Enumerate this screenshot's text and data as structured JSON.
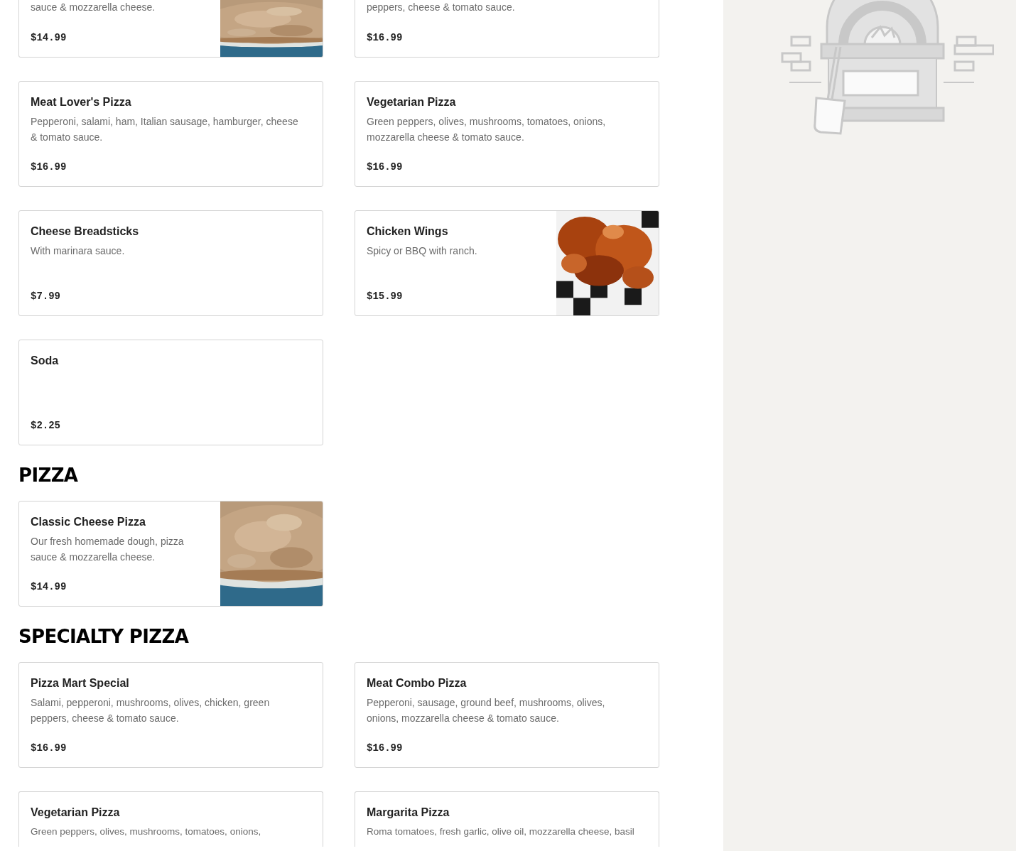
{
  "sections": [
    {
      "cards": [
        {
          "kind": "pizza_photo",
          "description": "sauce & mozzarella cheese.",
          "price": "$14.99"
        },
        {
          "kind": "plain",
          "description": "peppers, cheese & tomato sauce.",
          "price": "$16.99"
        },
        {
          "kind": "plain",
          "name": "Meat Lover's Pizza",
          "description": "Pepperoni, salami, ham, Italian sausage, hamburger, cheese & tomato sauce.",
          "price": "$16.99"
        },
        {
          "kind": "plain",
          "name": "Vegetarian Pizza",
          "description": "Green peppers, olives, mushrooms, tomatoes, onions, mozzarella cheese & tomato sauce.",
          "price": "$16.99"
        },
        {
          "kind": "plain",
          "name": "Cheese Breadsticks",
          "description": "With marinara sauce.",
          "price": "$7.99"
        },
        {
          "kind": "wings_photo",
          "name": "Chicken Wings",
          "description": "Spicy or BBQ with ranch.",
          "price": "$15.99"
        },
        {
          "kind": "plain",
          "name": "Soda",
          "price": "$2.25"
        }
      ]
    },
    {
      "title": "PIZZA",
      "cards": [
        {
          "kind": "pizza_photo",
          "name": "Classic Cheese Pizza",
          "description": "Our fresh homemade dough, pizza sauce & mozzarella cheese.",
          "price": "$14.99"
        }
      ]
    },
    {
      "title": "SPECIALTY PIZZA",
      "cards": [
        {
          "kind": "plain",
          "name": "Pizza Mart Special",
          "description": "Salami, pepperoni, mushrooms, olives, chicken, green peppers, cheese & tomato sauce.",
          "price": "$16.99"
        },
        {
          "kind": "plain",
          "name": "Meat Combo Pizza",
          "description": "Pepperoni, sausage, ground beef, mushrooms, olives, onions, mozzarella cheese & tomato sauce.",
          "price": "$16.99"
        },
        {
          "kind": "plain",
          "name": "Vegetarian Pizza",
          "description": "Green peppers, olives, mushrooms, tomatoes, onions,"
        },
        {
          "kind": "plain",
          "name": "Margarita Pizza",
          "description": "Roma tomatoes, fresh garlic, olive oil, mozzarella cheese, basil"
        }
      ]
    }
  ]
}
